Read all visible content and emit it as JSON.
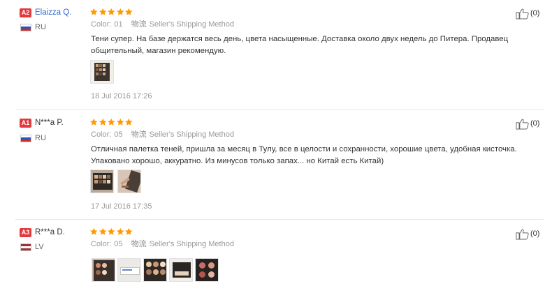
{
  "reviews": [
    {
      "badge": "A2",
      "badge_color": "#e4393c",
      "user": "Elaizza Q.",
      "user_color": "#3366cc",
      "country": "RU",
      "flag": "ru",
      "rating": 5,
      "color_label": "Color:",
      "color_value": "01",
      "shipping_cn": "物流",
      "shipping": "Seller's Shipping Method",
      "text": "Тени супер. На базе держатся весь день, цвета насыщенные. Доставка около двух недель до Питера. Продавец общительный, магазин рекомендую.",
      "photos": [
        "eyeshadow-palette-photo"
      ],
      "date": "18 Jul 2016 17:26",
      "helpful": "(0)"
    },
    {
      "badge": "A1",
      "badge_color": "#e4393c",
      "user": "N***a P.",
      "user_color": "#333333",
      "country": "RU",
      "flag": "ru",
      "rating": 5,
      "color_label": "Color:",
      "color_value": "05",
      "shipping_cn": "物流",
      "shipping": "Seller's Shipping Method",
      "text": "Отличная палетка теней, пришла за месяц в Тулу, все в целости и сохранности, хорошие цвета, удобная кисточка. Упаковано хорошо, аккуратно. Из минусов только запах... но Китай есть Китай)",
      "photos": [
        "eyeshadow-palette-photo",
        "palette-and-brush-photo"
      ],
      "date": "17 Jul 2016 17:35",
      "helpful": "(0)"
    },
    {
      "badge": "A3",
      "badge_color": "#e4393c",
      "user": "R***a D.",
      "user_color": "#333333",
      "country": "LV",
      "flag": "lv",
      "rating": 5,
      "color_label": "Color:",
      "color_value": "05",
      "shipping_cn": "物流",
      "shipping": "Seller's Shipping Method",
      "text": "",
      "photos": [
        "palette-closeup-photo",
        "package-label-photo",
        "palette-photo",
        "palette-photo",
        "palette-closed-photo"
      ],
      "date": "",
      "helpful": "(0)"
    }
  ],
  "icons": {
    "star": "star-icon",
    "helpful": "thumbs-up-icon"
  },
  "colors": {
    "star": "#ff9a00",
    "badge": "#e4393c",
    "link": "#3366cc",
    "meta": "#999999"
  }
}
